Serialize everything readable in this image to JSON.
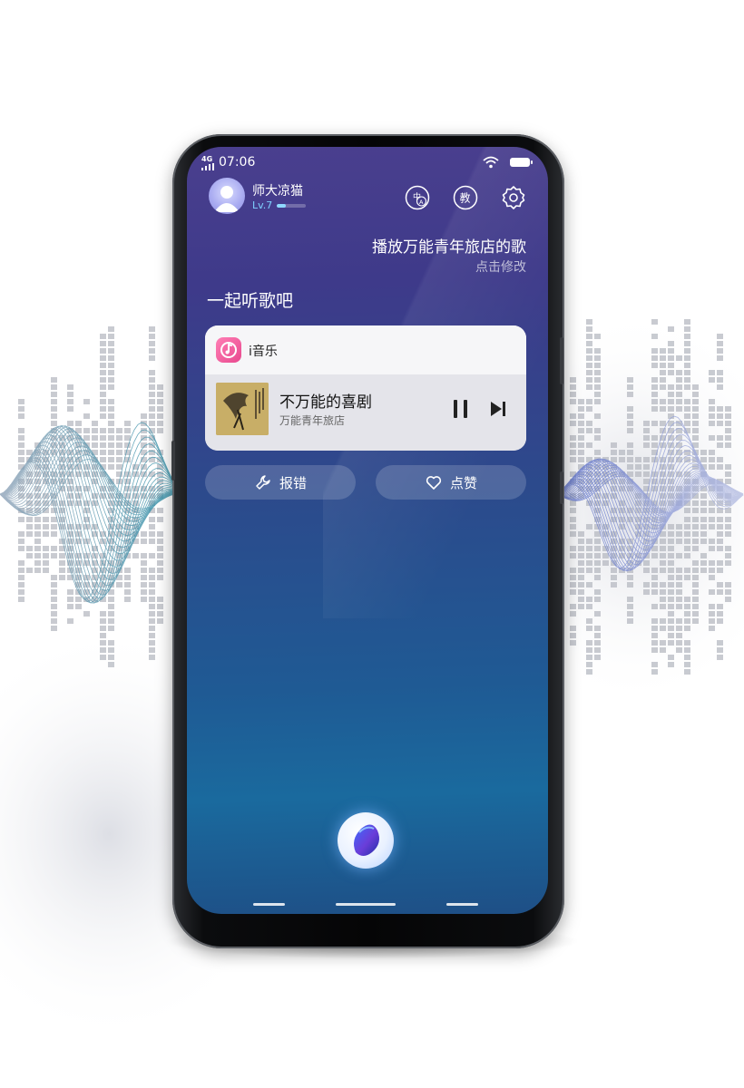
{
  "status_bar": {
    "network": "4G",
    "time": "07:06"
  },
  "header": {
    "username": "师大凉猫",
    "level": "Lv.7",
    "level_progress": 0.3,
    "icons": [
      "translate-icon",
      "education-icon",
      "settings-icon"
    ],
    "translate_glyph_main": "中",
    "translate_glyph_sub": "A",
    "education_glyph": "教"
  },
  "prompt": {
    "text": "播放万能青年旅店的歌",
    "hint": "点击修改"
  },
  "section_title": "一起听歌吧",
  "music_card": {
    "app_name": "i音乐",
    "song_title": "不万能的喜剧",
    "artist": "万能青年旅店",
    "state": "playing"
  },
  "actions": {
    "report_label": "报错",
    "like_label": "点赞"
  },
  "colors": {
    "screen_top": "#4a3f8e",
    "screen_bottom": "#1a6a9e",
    "app_accent": "#e8488e",
    "level_accent": "#8fd9ff"
  }
}
